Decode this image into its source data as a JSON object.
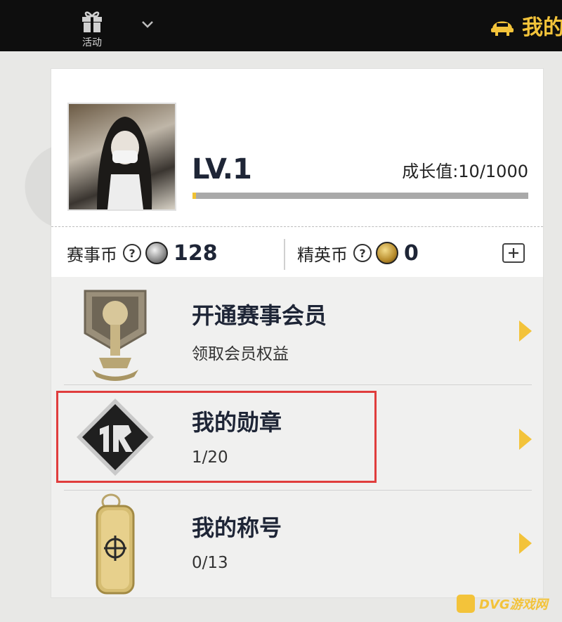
{
  "topbar": {
    "activity_label": "活动",
    "mine_label": "我的"
  },
  "profile": {
    "level": "LV.1",
    "growth_label": "成长值:10/1000",
    "growth_progress": 0.01
  },
  "currency": {
    "event_coin_label": "赛事币",
    "event_coin_value": "128",
    "elite_coin_label": "精英币",
    "elite_coin_value": "0"
  },
  "menu": [
    {
      "title": "开通赛事会员",
      "subtitle": "领取会员权益",
      "icon": "trophy-badge-icon"
    },
    {
      "title": "我的勋章",
      "subtitle": "1/20",
      "icon": "rng-medal-icon"
    },
    {
      "title": "我的称号",
      "subtitle": "0/13",
      "icon": "dog-tag-icon"
    }
  ],
  "watermark": {
    "text": "DVG游戏网"
  },
  "colors": {
    "accent": "#f3c33a",
    "text_dark": "#1e2536",
    "highlight": "#e03d3d"
  }
}
